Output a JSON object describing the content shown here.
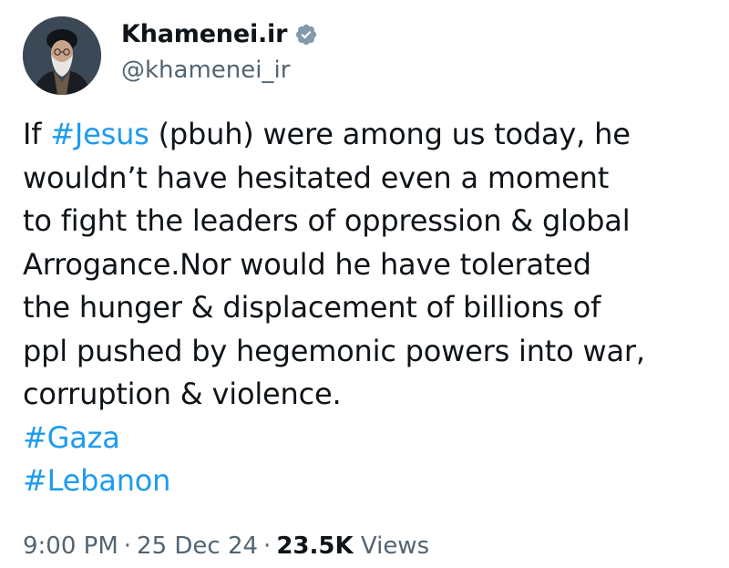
{
  "author": {
    "display_name": "Khamenei.ir",
    "handle": "@khamenei_ir",
    "verified_badge_icon": "verified-badge-icon",
    "badge_color": "#829aab"
  },
  "tweet": {
    "lines": [
      {
        "pre": "If ",
        "tag": "#Jesus",
        "post": " (pbuh) were among us today, he"
      },
      {
        "text": "wouldn’t have hesitated even a moment"
      },
      {
        "text": "to fight the leaders of oppression & global"
      },
      {
        "text": "Arrogance.Nor would he have tolerated"
      },
      {
        "text": "the hunger & displacement of billions of"
      },
      {
        "text": "ppl pushed by hegemonic powers into war,"
      },
      {
        "text": "corruption & violence."
      }
    ],
    "hashtags": [
      "#Gaza",
      "#Lebanon"
    ],
    "link_color": "#1d9bf0"
  },
  "meta": {
    "time": "9:00 PM",
    "separator": "·",
    "date": "25 Dec 24",
    "views_count": "23.5K",
    "views_label": "Views"
  }
}
